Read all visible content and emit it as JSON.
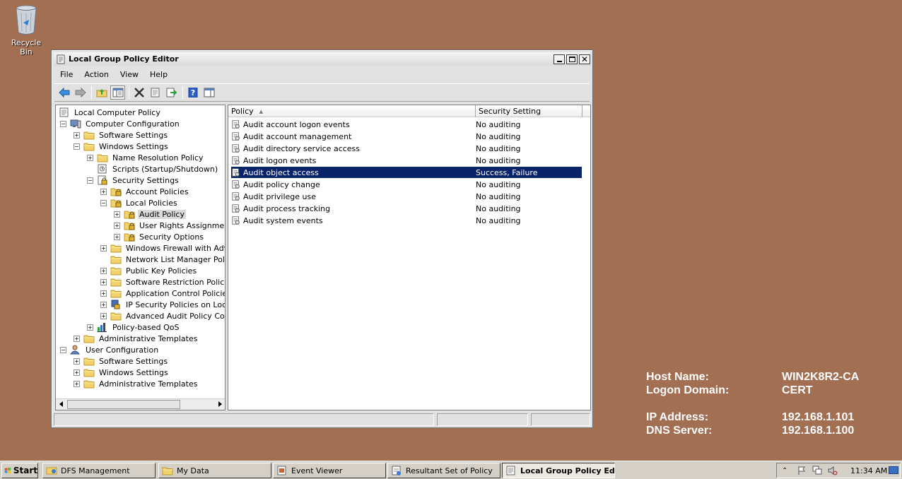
{
  "desktop": {
    "recycle_bin_label": "Recycle Bin"
  },
  "window": {
    "title": "Local Group Policy Editor",
    "menu": [
      "File",
      "Action",
      "View",
      "Help"
    ]
  },
  "tree": [
    {
      "label": "Local Computer Policy",
      "icon": "policy-document-icon",
      "expander": "none"
    },
    {
      "label": "Computer Configuration",
      "icon": "computer-icon",
      "expander": "minus"
    },
    {
      "label": "Software Settings",
      "icon": "folder-icon",
      "expander": "plus"
    },
    {
      "label": "Windows Settings",
      "icon": "folder-icon",
      "expander": "minus"
    },
    {
      "label": "Name Resolution Policy",
      "icon": "folder-icon",
      "expander": "plus"
    },
    {
      "label": "Scripts (Startup/Shutdown)",
      "icon": "script-icon",
      "expander": "none"
    },
    {
      "label": "Security Settings",
      "icon": "security-icon",
      "expander": "minus"
    },
    {
      "label": "Account Policies",
      "icon": "security-folder-icon",
      "expander": "plus"
    },
    {
      "label": "Local Policies",
      "icon": "security-folder-icon",
      "expander": "minus"
    },
    {
      "label": "Audit Policy",
      "icon": "security-folder-icon",
      "expander": "plus",
      "selected": true
    },
    {
      "label": "User Rights Assignment",
      "icon": "security-folder-icon",
      "expander": "plus"
    },
    {
      "label": "Security Options",
      "icon": "security-folder-icon",
      "expander": "plus"
    },
    {
      "label": "Windows Firewall with Advan",
      "icon": "folder-icon",
      "expander": "plus"
    },
    {
      "label": "Network List Manager Policies",
      "icon": "folder-icon",
      "expander": "none"
    },
    {
      "label": "Public Key Policies",
      "icon": "folder-icon",
      "expander": "plus"
    },
    {
      "label": "Software Restriction Policies",
      "icon": "folder-icon",
      "expander": "plus"
    },
    {
      "label": "Application Control Policies",
      "icon": "folder-icon",
      "expander": "plus"
    },
    {
      "label": "IP Security Policies on Local C",
      "icon": "ip-security-icon",
      "expander": "plus"
    },
    {
      "label": "Advanced Audit Policy Config",
      "icon": "folder-icon",
      "expander": "plus"
    },
    {
      "label": "Policy-based QoS",
      "icon": "chart-icon",
      "expander": "plus"
    },
    {
      "label": "Administrative Templates",
      "icon": "folder-icon",
      "expander": "plus"
    },
    {
      "label": "User Configuration",
      "icon": "user-icon",
      "expander": "minus"
    },
    {
      "label": "Software Settings",
      "icon": "folder-icon",
      "expander": "plus"
    },
    {
      "label": "Windows Settings",
      "icon": "folder-icon",
      "expander": "plus"
    },
    {
      "label": "Administrative Templates",
      "icon": "folder-icon",
      "expander": "plus"
    }
  ],
  "list": {
    "columns": [
      "Policy",
      "Security Setting"
    ],
    "rows": [
      {
        "policy": "Audit account logon events",
        "setting": "No auditing"
      },
      {
        "policy": "Audit account management",
        "setting": "No auditing"
      },
      {
        "policy": "Audit directory service access",
        "setting": "No auditing"
      },
      {
        "policy": "Audit logon events",
        "setting": "No auditing"
      },
      {
        "policy": "Audit object access",
        "setting": "Success, Failure",
        "selected": true
      },
      {
        "policy": "Audit policy change",
        "setting": "No auditing"
      },
      {
        "policy": "Audit privilege use",
        "setting": "No auditing"
      },
      {
        "policy": "Audit process tracking",
        "setting": "No auditing"
      },
      {
        "policy": "Audit system events",
        "setting": "No auditing"
      }
    ]
  },
  "bginfo": [
    {
      "key": "Host Name:",
      "value": "WIN2K8R2-CA"
    },
    {
      "key": "Logon Domain:",
      "value": "CERT"
    },
    {
      "key": "IP Address:",
      "value": "192.168.1.101"
    },
    {
      "key": "DNS Server:",
      "value": "192.168.1.100"
    }
  ],
  "taskbar": {
    "start_label": "Start",
    "buttons": [
      {
        "label": "DFS Management",
        "icon": "dfs-icon"
      },
      {
        "label": "My Data",
        "icon": "folder-icon"
      },
      {
        "label": "Event Viewer",
        "icon": "event-viewer-icon"
      },
      {
        "label": "Resultant Set of Policy",
        "icon": "rsop-icon"
      },
      {
        "label": "Local Group Policy Edi...",
        "icon": "policy-document-icon",
        "active": true
      }
    ],
    "clock": "11:34 AM"
  },
  "colors": {
    "desktop": "#A36F53",
    "selection": "#0A246A",
    "window": "#E2E2E2"
  }
}
